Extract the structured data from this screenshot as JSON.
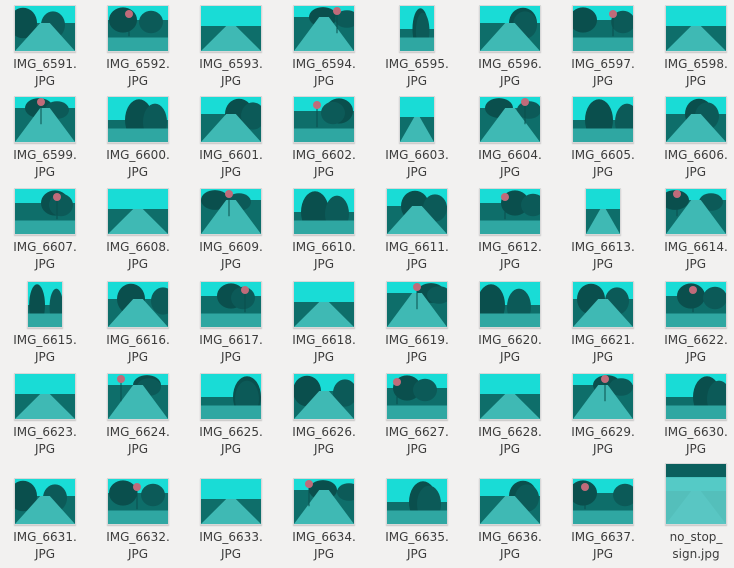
{
  "colors": {
    "background": "#f2f1f0",
    "text": "#3c3c3c",
    "photo_dark": "#0b5f5d",
    "photo_bright": "#19dcd6"
  },
  "files": [
    {
      "name": "IMG_6591.\nJPG",
      "icon": "image-thumbnail"
    },
    {
      "name": "IMG_6592.\nJPG",
      "icon": "image-thumbnail"
    },
    {
      "name": "IMG_6593.\nJPG",
      "icon": "image-thumbnail"
    },
    {
      "name": "IMG_6594.\nJPG",
      "icon": "image-thumbnail"
    },
    {
      "name": "IMG_6595.\nJPG",
      "icon": "image-thumbnail"
    },
    {
      "name": "IMG_6596.\nJPG",
      "icon": "image-thumbnail"
    },
    {
      "name": "IMG_6597.\nJPG",
      "icon": "image-thumbnail"
    },
    {
      "name": "IMG_6598.\nJPG",
      "icon": "image-thumbnail"
    },
    {
      "name": "IMG_6599.\nJPG",
      "icon": "image-thumbnail"
    },
    {
      "name": "IMG_6600.\nJPG",
      "icon": "image-thumbnail"
    },
    {
      "name": "IMG_6601.\nJPG",
      "icon": "image-thumbnail"
    },
    {
      "name": "IMG_6602.\nJPG",
      "icon": "image-thumbnail"
    },
    {
      "name": "IMG_6603.\nJPG",
      "icon": "image-thumbnail"
    },
    {
      "name": "IMG_6604.\nJPG",
      "icon": "image-thumbnail"
    },
    {
      "name": "IMG_6605.\nJPG",
      "icon": "image-thumbnail"
    },
    {
      "name": "IMG_6606.\nJPG",
      "icon": "image-thumbnail"
    },
    {
      "name": "IMG_6607.\nJPG",
      "icon": "image-thumbnail"
    },
    {
      "name": "IMG_6608.\nJPG",
      "icon": "image-thumbnail"
    },
    {
      "name": "IMG_6609.\nJPG",
      "icon": "image-thumbnail"
    },
    {
      "name": "IMG_6610.\nJPG",
      "icon": "image-thumbnail"
    },
    {
      "name": "IMG_6611.\nJPG",
      "icon": "image-thumbnail"
    },
    {
      "name": "IMG_6612.\nJPG",
      "icon": "image-thumbnail"
    },
    {
      "name": "IMG_6613.\nJPG",
      "icon": "image-thumbnail"
    },
    {
      "name": "IMG_6614.\nJPG",
      "icon": "image-thumbnail"
    },
    {
      "name": "IMG_6615.\nJPG",
      "icon": "image-thumbnail"
    },
    {
      "name": "IMG_6616.\nJPG",
      "icon": "image-thumbnail"
    },
    {
      "name": "IMG_6617.\nJPG",
      "icon": "image-thumbnail"
    },
    {
      "name": "IMG_6618.\nJPG",
      "icon": "image-thumbnail"
    },
    {
      "name": "IMG_6619.\nJPG",
      "icon": "image-thumbnail"
    },
    {
      "name": "IMG_6620.\nJPG",
      "icon": "image-thumbnail"
    },
    {
      "name": "IMG_6621.\nJPG",
      "icon": "image-thumbnail"
    },
    {
      "name": "IMG_6622.\nJPG",
      "icon": "image-thumbnail"
    },
    {
      "name": "IMG_6623.\nJPG",
      "icon": "image-thumbnail"
    },
    {
      "name": "IMG_6624.\nJPG",
      "icon": "image-thumbnail"
    },
    {
      "name": "IMG_6625.\nJPG",
      "icon": "image-thumbnail"
    },
    {
      "name": "IMG_6626.\nJPG",
      "icon": "image-thumbnail"
    },
    {
      "name": "IMG_6627.\nJPG",
      "icon": "image-thumbnail"
    },
    {
      "name": "IMG_6628.\nJPG",
      "icon": "image-thumbnail"
    },
    {
      "name": "IMG_6629.\nJPG",
      "icon": "image-thumbnail"
    },
    {
      "name": "IMG_6630.\nJPG",
      "icon": "image-thumbnail"
    },
    {
      "name": "IMG_6631.\nJPG",
      "icon": "image-thumbnail"
    },
    {
      "name": "IMG_6632.\nJPG",
      "icon": "image-thumbnail"
    },
    {
      "name": "IMG_6633.\nJPG",
      "icon": "image-thumbnail"
    },
    {
      "name": "IMG_6634.\nJPG",
      "icon": "image-thumbnail"
    },
    {
      "name": "IMG_6635.\nJPG",
      "icon": "image-thumbnail"
    },
    {
      "name": "IMG_6636.\nJPG",
      "icon": "image-thumbnail"
    },
    {
      "name": "IMG_6637.\nJPG",
      "icon": "image-thumbnail"
    },
    {
      "name": "no_stop_\nsign.jpg",
      "icon": "image-thumbnail"
    }
  ]
}
